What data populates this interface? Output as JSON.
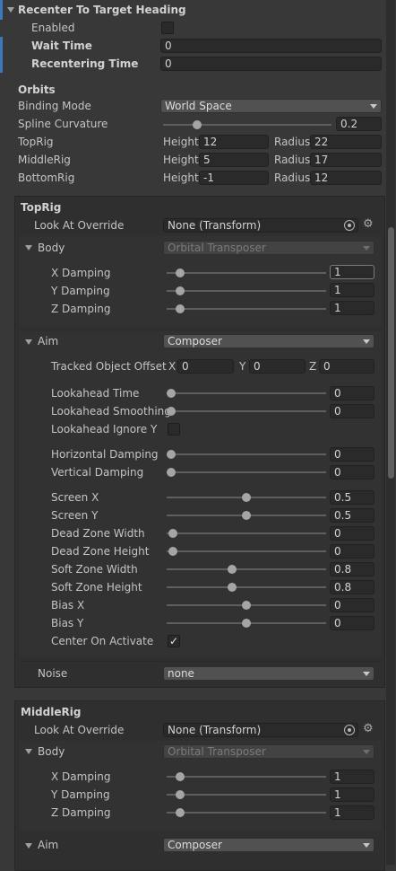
{
  "recenter": {
    "title": "Recenter To Target Heading",
    "enabled_label": "Enabled",
    "wait_time_label": "Wait Time",
    "wait_time_value": "0",
    "recentering_time_label": "Recentering Time",
    "recentering_time_value": "0"
  },
  "orbits": {
    "header": "Orbits",
    "binding_mode_label": "Binding Mode",
    "binding_mode_value": "World Space",
    "spline_curvature_label": "Spline Curvature",
    "spline_curvature_value": "0.2",
    "spline_curvature_fraction": 0.2,
    "height_label": "Height",
    "radius_label": "Radius",
    "rigs": [
      {
        "name": "TopRig",
        "height": "12",
        "radius": "22"
      },
      {
        "name": "MiddleRig",
        "height": "5",
        "radius": "17"
      },
      {
        "name": "BottomRig",
        "height": "-1",
        "radius": "12"
      }
    ]
  },
  "toprig": {
    "title": "TopRig",
    "look_at_label": "Look At Override",
    "look_at_value": "None (Transform)",
    "body_label": "Body",
    "body_value": "Orbital Transposer",
    "damping": [
      {
        "label": "X Damping",
        "value": "1"
      },
      {
        "label": "Y Damping",
        "value": "1"
      },
      {
        "label": "Z Damping",
        "value": "1"
      }
    ],
    "aim_label": "Aim",
    "aim_value": "Composer",
    "tracked_offset_label": "Tracked Object Offset",
    "x_label": "X",
    "x_value": "0",
    "y_label": "Y",
    "y_value": "0",
    "z_label": "Z",
    "z_value": "0",
    "lookahead_time_label": "Lookahead Time",
    "lookahead_time_value": "0",
    "lookahead_smoothing_label": "Lookahead Smoothing",
    "lookahead_smoothing_value": "0",
    "lookahead_ignore_y_label": "Lookahead Ignore Y",
    "horizontal_damping_label": "Horizontal Damping",
    "horizontal_damping_value": "0",
    "vertical_damping_label": "Vertical Damping",
    "vertical_damping_value": "0",
    "screen": [
      {
        "label": "Screen X",
        "value": "0.5"
      },
      {
        "label": "Screen Y",
        "value": "0.5"
      },
      {
        "label": "Dead Zone Width",
        "value": "0"
      },
      {
        "label": "Dead Zone Height",
        "value": "0"
      },
      {
        "label": "Soft Zone Width",
        "value": "0.8"
      },
      {
        "label": "Soft Zone Height",
        "value": "0.8"
      },
      {
        "label": "Bias X",
        "value": "0"
      },
      {
        "label": "Bias Y",
        "value": "0"
      }
    ],
    "center_on_activate_label": "Center On Activate",
    "center_on_activate_check": "✓",
    "noise_label": "Noise",
    "noise_value": "none"
  },
  "middlerig": {
    "title": "MiddleRig",
    "look_at_label": "Look At Override",
    "look_at_value": "None (Transform)",
    "body_label": "Body",
    "body_value": "Orbital Transposer",
    "damping": [
      {
        "label": "X Damping",
        "value": "1"
      },
      {
        "label": "Y Damping",
        "value": "1"
      },
      {
        "label": "Z Damping",
        "value": "1"
      }
    ],
    "aim_label": "Aim",
    "aim_value": "Composer"
  }
}
